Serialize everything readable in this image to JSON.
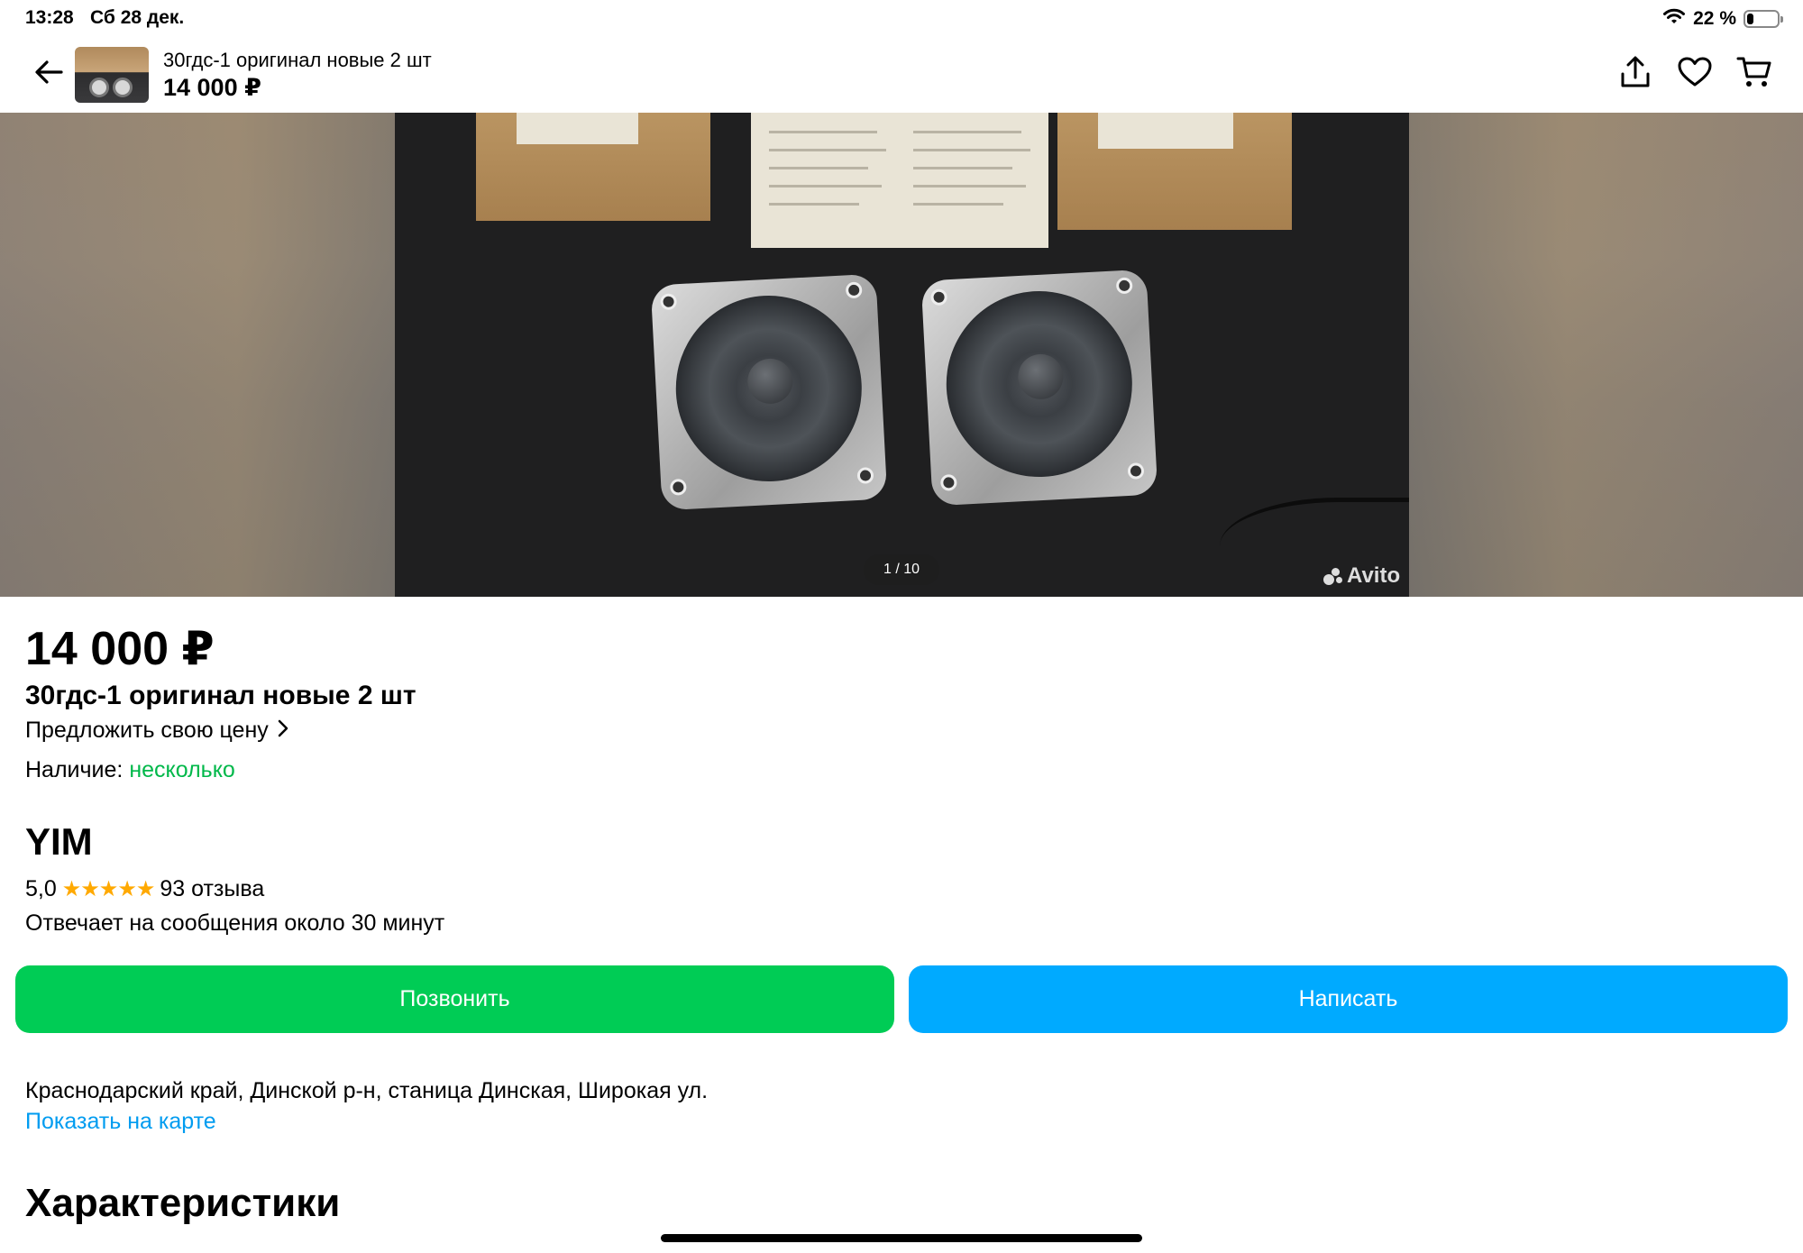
{
  "status_bar": {
    "time": "13:28",
    "date": "Сб 28 дек.",
    "battery_text": "22 %",
    "battery_level": 0.22,
    "icons": [
      "wifi-icon",
      "battery-icon"
    ]
  },
  "top_bar": {
    "title": "30гдс-1 оригинал новые 2 шт",
    "price": "14 000 ₽",
    "icons": [
      "back-arrow-icon",
      "share-icon",
      "heart-icon",
      "cart-icon"
    ]
  },
  "gallery": {
    "counter": "1 / 10",
    "watermark": "Avito"
  },
  "listing": {
    "price": "14 000 ₽",
    "title": "30гдс-1 оригинал новые 2 шт",
    "offer_label": "Предложить свою цену",
    "availability_label": "Наличие:",
    "availability_value": "несколько"
  },
  "seller": {
    "name": "YIM",
    "rating": "5,0",
    "stars": "★★★★★",
    "reviews": "93 отзыва",
    "response": "Отвечает на сообщения около 30 минут"
  },
  "actions": {
    "call": "Позвонить",
    "message": "Написать"
  },
  "location": {
    "address": "Краснодарский край, Динской р-н, станица Динская, Широкая ул.",
    "map_link": "Показать на карте"
  },
  "sections": {
    "characteristics": "Характеристики"
  },
  "colors": {
    "call_button": "#00cc55",
    "message_button": "#00aaff",
    "availability": "#00b84a",
    "link": "#009cf0",
    "stars": "#ffa900"
  }
}
